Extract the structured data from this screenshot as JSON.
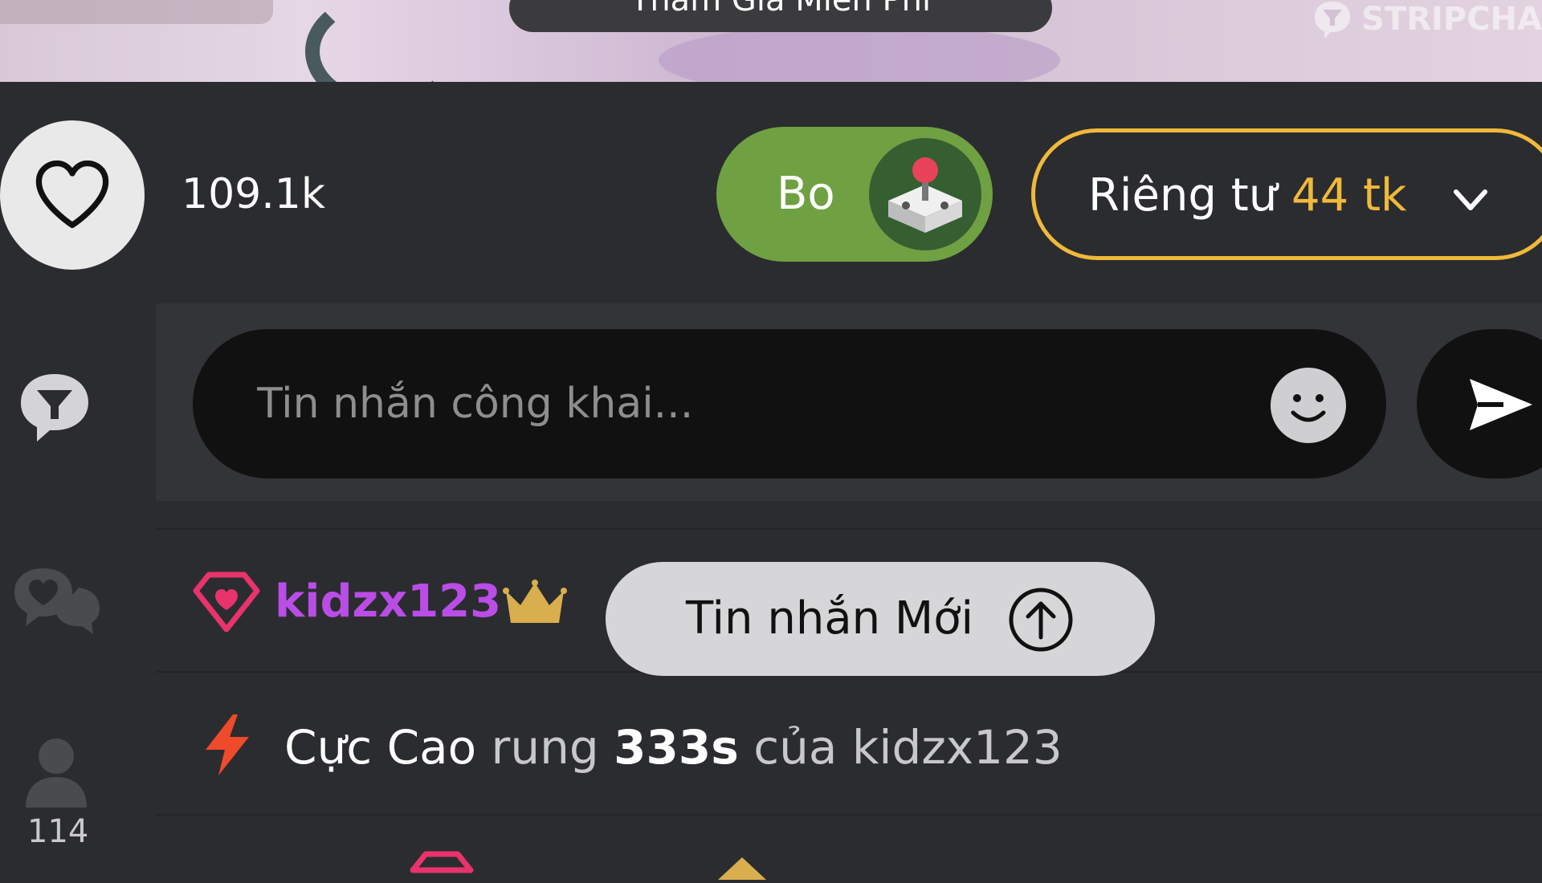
{
  "video": {
    "join_button_label": "Tham Gia Miễn Phí",
    "watermark_text": "STRIPCHA"
  },
  "actions": {
    "likes_count": "109.1k",
    "tip_button_label": "Bo",
    "private_label": "Riêng tư",
    "private_price": "44 tk"
  },
  "composer": {
    "placeholder": "Tin nhắn công khai..."
  },
  "sidebar": {
    "viewers_count": "114"
  },
  "chat": {
    "messages": [
      {
        "username": "kidzx123",
        "emote": "=)))"
      },
      {
        "prefix": "Cực Cao",
        "verb": "rung",
        "duration": "333s",
        "suffix": "của kidzx123"
      }
    ]
  },
  "new_messages_button": "Tin nhắn Mới",
  "colors": {
    "accent_green": "#6fa142",
    "private_gold": "#f0b93b",
    "username_purple": "#b94de6",
    "badge_pink": "#e8336d",
    "lightning_red": "#ef4a2b",
    "crown_gold": "#d8ae4e"
  }
}
